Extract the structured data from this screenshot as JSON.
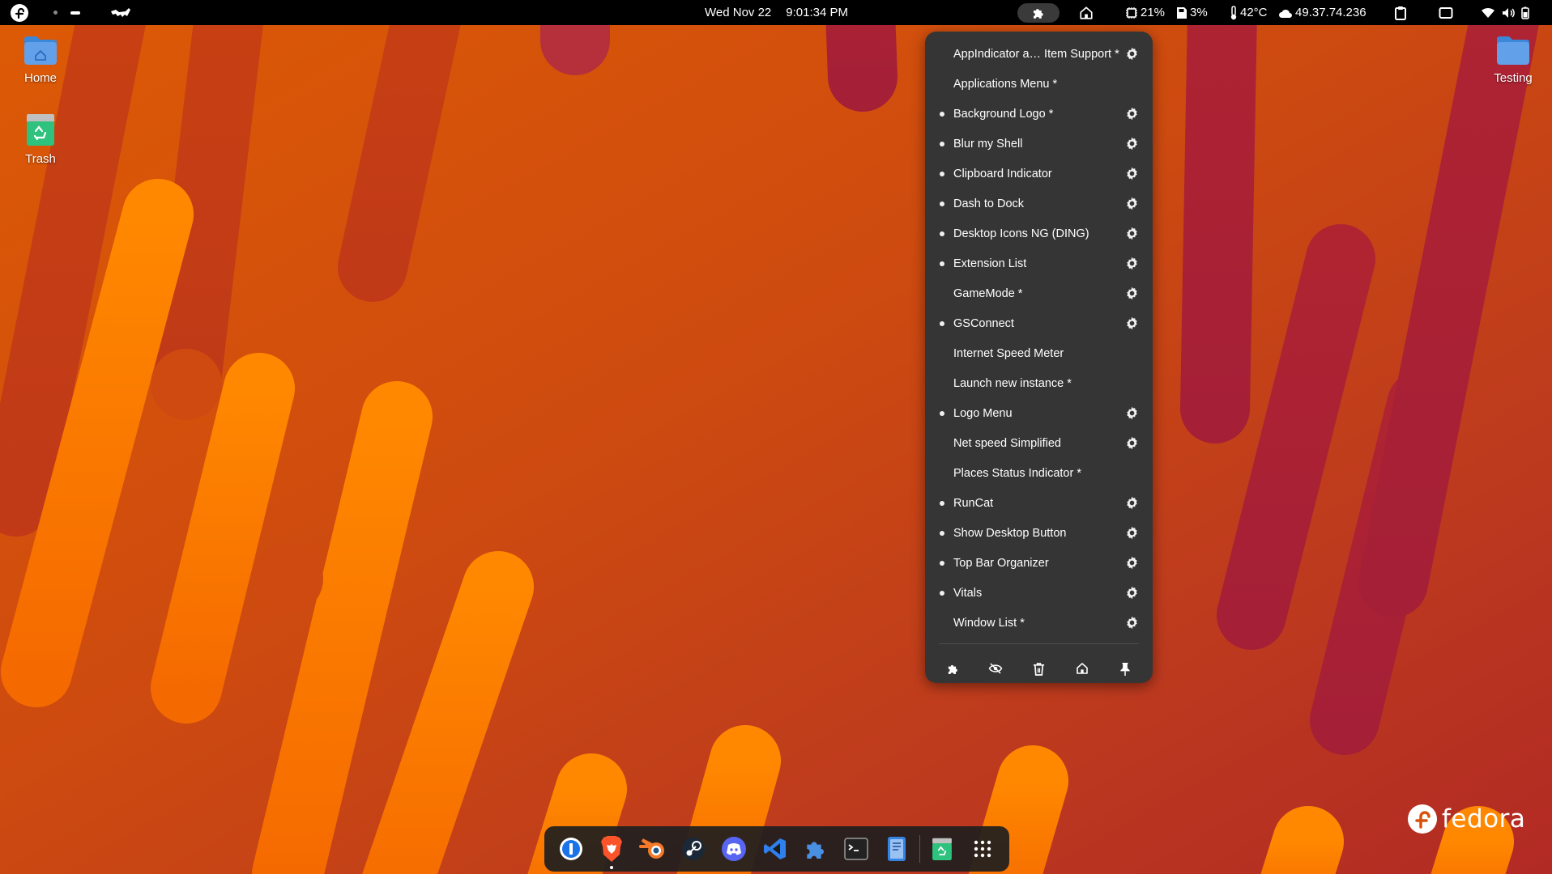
{
  "topbar": {
    "date": "Wed Nov 22",
    "time": "9:01:34 PM",
    "vitals": {
      "cpu": "21%",
      "memory": "3%",
      "temperature": "42°C",
      "ip": "49.37.74.236"
    }
  },
  "desktop": {
    "icons_left": [
      {
        "label": "Home",
        "icon": "folder-home-icon"
      },
      {
        "label": "Trash",
        "icon": "trash-icon"
      }
    ],
    "icons_right": [
      {
        "label": "Testing",
        "icon": "folder-icon"
      }
    ]
  },
  "extension_menu": {
    "items": [
      {
        "name": "AppIndicator a… Item Support *",
        "enabled": false,
        "has_settings": true
      },
      {
        "name": "Applications Menu *",
        "enabled": false,
        "has_settings": false
      },
      {
        "name": "Background Logo *",
        "enabled": true,
        "has_settings": true
      },
      {
        "name": "Blur my Shell",
        "enabled": true,
        "has_settings": true
      },
      {
        "name": "Clipboard Indicator",
        "enabled": true,
        "has_settings": true
      },
      {
        "name": "Dash to Dock",
        "enabled": true,
        "has_settings": true
      },
      {
        "name": "Desktop Icons NG (DING)",
        "enabled": true,
        "has_settings": true
      },
      {
        "name": "Extension List",
        "enabled": true,
        "has_settings": true
      },
      {
        "name": "GameMode *",
        "enabled": false,
        "has_settings": true
      },
      {
        "name": "GSConnect",
        "enabled": true,
        "has_settings": true
      },
      {
        "name": "Internet Speed Meter",
        "enabled": false,
        "has_settings": false
      },
      {
        "name": "Launch new instance *",
        "enabled": false,
        "has_settings": false
      },
      {
        "name": "Logo Menu",
        "enabled": true,
        "has_settings": true
      },
      {
        "name": "Net speed Simplified",
        "enabled": false,
        "has_settings": true
      },
      {
        "name": "Places Status Indicator *",
        "enabled": false,
        "has_settings": false
      },
      {
        "name": "RunCat",
        "enabled": true,
        "has_settings": true
      },
      {
        "name": "Show Desktop Button",
        "enabled": true,
        "has_settings": true
      },
      {
        "name": "Top Bar Organizer",
        "enabled": true,
        "has_settings": true
      },
      {
        "name": "Vitals",
        "enabled": true,
        "has_settings": true
      },
      {
        "name": "Window List *",
        "enabled": false,
        "has_settings": true
      }
    ],
    "toolbar": [
      "extensions-icon",
      "hide-icon",
      "trash-icon",
      "home-icon",
      "pin-icon"
    ]
  },
  "dock": {
    "apps": [
      {
        "icon": "1password-icon",
        "running": false
      },
      {
        "icon": "brave-icon",
        "running": true
      },
      {
        "icon": "blender-icon",
        "running": false
      },
      {
        "icon": "steam-icon",
        "running": false
      },
      {
        "icon": "discord-icon",
        "running": false
      },
      {
        "icon": "vscode-icon",
        "running": false
      },
      {
        "icon": "extensions-app-icon",
        "running": false
      },
      {
        "icon": "terminal-icon",
        "running": false
      },
      {
        "icon": "text-editor-icon",
        "running": false
      },
      {
        "icon": "trash-icon",
        "running": false
      },
      {
        "icon": "app-grid-icon",
        "running": false
      }
    ]
  },
  "branding": {
    "wordmark": "fedora"
  },
  "colors": {
    "topbar": "#000000",
    "menu_bg": "#353535",
    "wallpaper_orange": "#ff7a00",
    "wallpaper_red": "#a81f38"
  }
}
